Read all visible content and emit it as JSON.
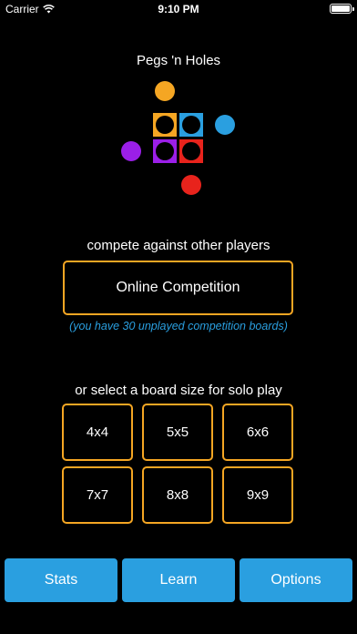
{
  "status_bar": {
    "carrier": "Carrier",
    "time": "9:10 PM",
    "wifi_icon": "wifi-icon",
    "battery_icon": "battery-full-icon"
  },
  "app_title": "Pegs 'n Holes",
  "logo": {
    "colors": {
      "orange": "#f5a623",
      "blue": "#2a9fe0",
      "purple": "#9b1fe8",
      "red": "#e8231c",
      "hole": "#000000"
    }
  },
  "competition": {
    "label": "compete against other players",
    "button_label": "Online Competition",
    "unplayed_note": "(you have 30 unplayed competition boards)"
  },
  "solo": {
    "label": "or select a board size for solo play",
    "sizes": [
      "4x4",
      "5x5",
      "6x6",
      "7x7",
      "8x8",
      "9x9"
    ]
  },
  "bottom_bar": {
    "stats_label": "Stats",
    "learn_label": "Learn",
    "options_label": "Options"
  },
  "theme": {
    "accent_orange": "#f5a623",
    "accent_blue": "#2a9fe0",
    "background": "#000000"
  }
}
